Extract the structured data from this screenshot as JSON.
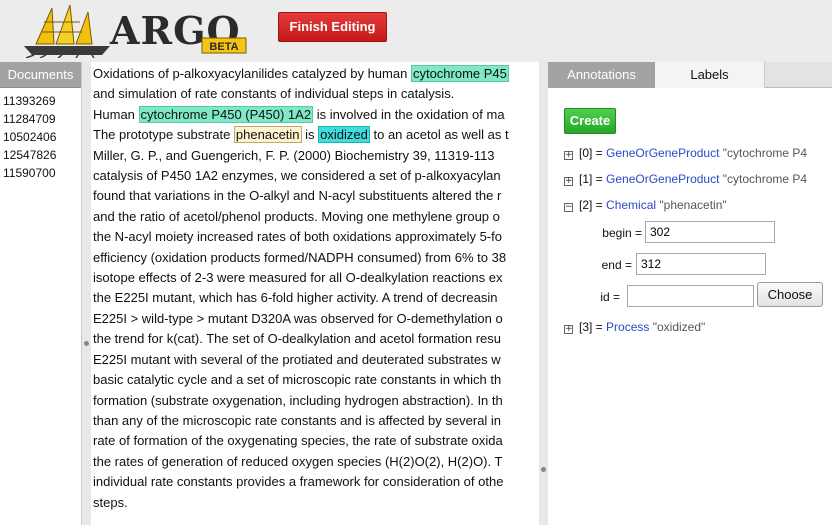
{
  "header": {
    "logo_text": "ARGO",
    "logo_badge": "BETA",
    "finish_button": "Finish Editing"
  },
  "documents": {
    "header": "Documents",
    "items": [
      "11393269",
      "11284709",
      "10502406",
      "12547826",
      "11590700"
    ]
  },
  "main_text": {
    "lines": [
      [
        {
          "t": "Oxidations of p-alkoxyacylanilides catalyzed by human "
        },
        {
          "t": "cytochrome P45",
          "cls": "gene"
        }
      ],
      [
        {
          "t": "and simulation of rate constants of individual steps in catalysis."
        }
      ],
      [
        {
          "t": "Human "
        },
        {
          "t": "cytochrome P450 (P450) 1A2",
          "cls": "gene"
        },
        {
          "t": " is involved in the oxidation of ma"
        }
      ],
      [
        {
          "t": "The prototype substrate "
        },
        {
          "t": "phenacetin",
          "cls": "chem"
        },
        {
          "t": " is "
        },
        {
          "t": "oxidized",
          "cls": "proc"
        },
        {
          "t": " to an acetol as well as t"
        }
      ],
      [
        {
          "t": "Miller, G. P., and Guengerich, F. P. (2000) Biochemistry 39, 11319-113"
        }
      ],
      [
        {
          "t": "catalysis of P450 1A2 enzymes, we considered a set of p-alkoxyacylan"
        }
      ],
      [
        {
          "t": "found that variations in the O-alkyl and N-acyl substituents altered the r"
        }
      ],
      [
        {
          "t": "and the ratio of acetol/phenol products. Moving one methylene group o"
        }
      ],
      [
        {
          "t": "the N-acyl moiety increased rates of both oxidations approximately 5-fo"
        }
      ],
      [
        {
          "t": "efficiency (oxidation products formed/NADPH consumed) from 6% to 38"
        }
      ],
      [
        {
          "t": "isotope effects of 2-3 were measured for all O-dealkylation reactions ex"
        }
      ],
      [
        {
          "t": "the E225I mutant, which has 6-fold higher activity. A trend of decreasin"
        }
      ],
      [
        {
          "t": "E225I > wild-type > mutant D320A was observed for O-demethylation o"
        }
      ],
      [
        {
          "t": "the trend for k(cat). The set of O-dealkylation and acetol formation resu"
        }
      ],
      [
        {
          "t": "E225I mutant with several of the protiated and deuterated substrates w"
        }
      ],
      [
        {
          "t": "basic catalytic cycle and a set of microscopic rate constants in which th"
        }
      ],
      [
        {
          "t": "formation (substrate oxygenation, including hydrogen abstraction). In th"
        }
      ],
      [
        {
          "t": "than any of the microscopic rate constants and is affected by several in"
        }
      ],
      [
        {
          "t": "rate of formation of the oxygenating species, the rate of substrate oxida"
        }
      ],
      [
        {
          "t": "the rates of generation of reduced oxygen species (H(2)O(2), H(2)O). T"
        }
      ],
      [
        {
          "t": "individual rate constants provides a framework for consideration of othe"
        }
      ],
      [
        {
          "t": "steps."
        }
      ]
    ]
  },
  "annotations_panel": {
    "tabs": [
      "Annotations",
      "Labels"
    ],
    "create_button": "Create",
    "items": [
      {
        "index": "[0] =",
        "type": "GeneOrGeneProduct",
        "value": "\"cytochrome P4",
        "toggle": "+"
      },
      {
        "index": "[1] =",
        "type": "GeneOrGeneProduct",
        "value": "\"cytochrome P4",
        "toggle": "+"
      },
      {
        "index": "[2] =",
        "type": "Chemical",
        "value": "\"phenacetin\"",
        "toggle": "−"
      },
      {
        "index": "[3] =",
        "type": "Process",
        "value": "\"oxidized\"",
        "toggle": "+"
      }
    ],
    "detail": {
      "begin_label": "begin =",
      "begin_value": "302",
      "end_label": "end =",
      "end_value": "312",
      "id_label": "id =",
      "id_value": "",
      "choose_button": "Choose"
    }
  },
  "colors": {
    "finish_button": "#d42a2a",
    "create_button": "#33b833",
    "gene_highlight": "#7fe8c6",
    "chemical_highlight": "#fdf3cf",
    "process_highlight": "#40dcde",
    "annotation_type_link": "#2a49c8",
    "panel_header_gray": "#a3a3a3"
  }
}
